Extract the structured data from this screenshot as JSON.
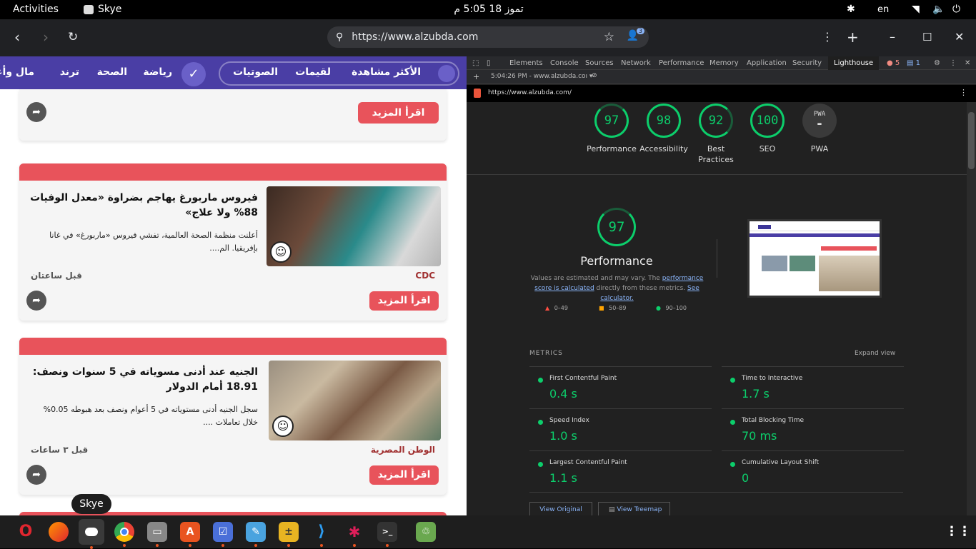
{
  "system": {
    "activities": "Activities",
    "app_name": "Skye",
    "clock": "تموز 18  5:05 م",
    "language": "en"
  },
  "browser": {
    "url": "https://www.alzubda.com",
    "profile_badge": "3"
  },
  "site": {
    "nav": {
      "items": [
        "الأكثر مشاهدة",
        "لقيمات",
        "الصوتيات",
        "رياضة",
        "الصحة",
        "ترند",
        "مال وأعمال"
      ]
    },
    "read_more": "اقرأ المزيد",
    "articles": [
      {
        "title": "فيروس ماربورغ يهاجم بضراوة «معدل الوفيات 88% ولا علاج»",
        "desc": "أعلنت منظمة الصحة العالمية، تفشي فيروس «ماربورغ» في غانا بإفريقيا. الم....",
        "source": "CDC",
        "time": "قبل ساعتان"
      },
      {
        "title": "الجنيه عند أدنى مسوياته في 5 سنوات ونصف: 18.91 أمام الدولار",
        "desc": "سجل الجنيه أدنى مستوياته في 5 أعوام ونصف بعد هبوطه 0.05% خلال تعاملات ....",
        "source": "الوطن المصرية",
        "time": "قبل ٣ ساعات"
      }
    ]
  },
  "devtools": {
    "tabs": [
      "Elements",
      "Console",
      "Sources",
      "Network",
      "Performance",
      "Memory",
      "Application",
      "Security",
      "Lighthouse"
    ],
    "active_tab": "Lighthouse",
    "errors": "5",
    "messages": "1",
    "report_select": "5:04:26 PM - www.alzubda.coı ▾",
    "report_url": "https://www.alzubda.com/"
  },
  "lighthouse": {
    "scores": [
      {
        "label": "Performance",
        "value": 97
      },
      {
        "label": "Accessibility",
        "value": 98
      },
      {
        "label": "Best Practices",
        "value": 92
      },
      {
        "label": "SEO",
        "value": 100
      }
    ],
    "pwa_label": "PWA",
    "pwa_badge": "PWA",
    "main_score": 97,
    "main_label": "Performance",
    "note_1": "Values are estimated and may vary. The",
    "note_link_1": "performance score is calculated",
    "note_2": "directly from these metrics.",
    "note_link_2": "See calculator.",
    "legend": [
      "0–49",
      "50–89",
      "90–100"
    ],
    "metrics_header": "METRICS",
    "expand": "Expand view",
    "metrics": [
      {
        "name": "First Contentful Paint",
        "value": "0.4 s"
      },
      {
        "name": "Time to Interactive",
        "value": "1.7 s"
      },
      {
        "name": "Speed Index",
        "value": "1.0 s"
      },
      {
        "name": "Total Blocking Time",
        "value": "70 ms"
      },
      {
        "name": "Largest Contentful Paint",
        "value": "1.1 s"
      },
      {
        "name": "Cumulative Layout Shift",
        "value": "0"
      }
    ],
    "btn_trace": "View Original Trace",
    "btn_treemap": "View Treemap"
  },
  "dock": {
    "tooltip": "Skye"
  },
  "colors": {
    "site_nav": "#4a3ea5",
    "accent_red": "#e8535b",
    "lh_green": "#0cce6b"
  }
}
